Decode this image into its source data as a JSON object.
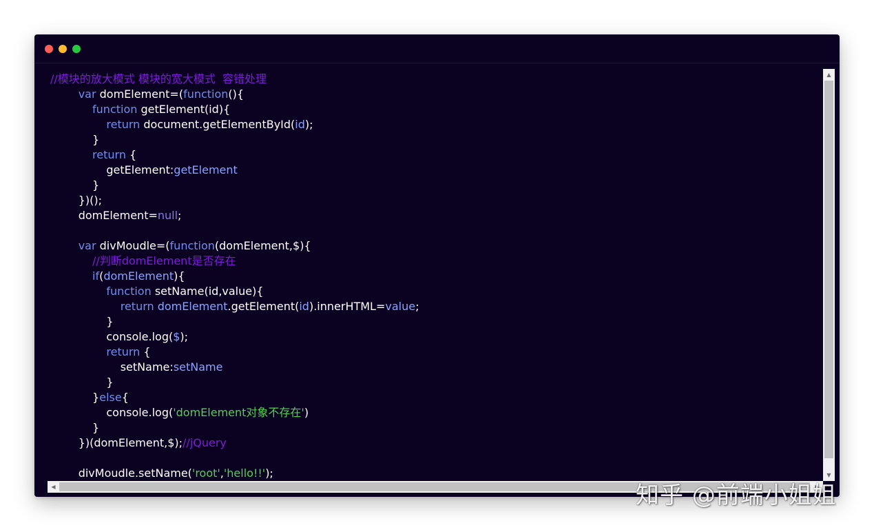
{
  "window": {
    "controls": [
      {
        "name": "close",
        "color": "#ff5f57"
      },
      {
        "name": "minimize",
        "color": "#febc2e"
      },
      {
        "name": "maximize",
        "color": "#28c840"
      }
    ]
  },
  "colors": {
    "background": "#0b0120",
    "comment": "#7a1fd6",
    "keyword": "#6f8ff2",
    "identifier": "#ffffff",
    "string": "#4fd44f",
    "literal": "#8a78e6"
  },
  "code": {
    "lines": [
      [
        [
          "comment",
          "//模块的放大模式 模块的宽大模式  容错处理"
        ]
      ],
      [
        [
          "punct",
          "        "
        ],
        [
          "keyword",
          "var"
        ],
        [
          "ident",
          " domElement="
        ],
        [
          "punct",
          "("
        ],
        [
          "keyword",
          "function"
        ],
        [
          "punct",
          "(){"
        ]
      ],
      [
        [
          "punct",
          "            "
        ],
        [
          "keyword",
          "function"
        ],
        [
          "ident",
          " getElement(id){"
        ]
      ],
      [
        [
          "punct",
          "                "
        ],
        [
          "keyword",
          "return"
        ],
        [
          "ident",
          " document.getElementById("
        ],
        [
          "prop",
          "id"
        ],
        [
          "punct",
          ");"
        ]
      ],
      [
        [
          "punct",
          "            }"
        ]
      ],
      [
        [
          "punct",
          "            "
        ],
        [
          "keyword",
          "return"
        ],
        [
          "punct",
          " {"
        ]
      ],
      [
        [
          "punct",
          "                "
        ],
        [
          "ident",
          "getElement:"
        ],
        [
          "prop",
          "getElement"
        ]
      ],
      [
        [
          "punct",
          "            }"
        ]
      ],
      [
        [
          "punct",
          "        })();"
        ]
      ],
      [
        [
          "punct",
          "        "
        ],
        [
          "ident",
          "domElement="
        ],
        [
          "literal",
          "null"
        ],
        [
          "punct",
          ";"
        ]
      ],
      [
        [
          "punct",
          ""
        ]
      ],
      [
        [
          "punct",
          "        "
        ],
        [
          "keyword",
          "var"
        ],
        [
          "ident",
          " divMoudle="
        ],
        [
          "punct",
          "("
        ],
        [
          "keyword",
          "function"
        ],
        [
          "ident",
          "(domElement,$){"
        ]
      ],
      [
        [
          "punct",
          "            "
        ],
        [
          "comment",
          "//判断domElement是否存在"
        ]
      ],
      [
        [
          "punct",
          "            "
        ],
        [
          "keyword",
          "if"
        ],
        [
          "punct",
          "("
        ],
        [
          "prop",
          "domElement"
        ],
        [
          "punct",
          "){"
        ]
      ],
      [
        [
          "punct",
          "                "
        ],
        [
          "keyword",
          "function"
        ],
        [
          "ident",
          " setName(id,value){"
        ]
      ],
      [
        [
          "punct",
          "                    "
        ],
        [
          "keyword",
          "return"
        ],
        [
          "punct",
          " "
        ],
        [
          "prop",
          "domElement"
        ],
        [
          "ident",
          ".getElement("
        ],
        [
          "prop",
          "id"
        ],
        [
          "ident",
          ").innerHTML="
        ],
        [
          "prop",
          "value"
        ],
        [
          "punct",
          ";"
        ]
      ],
      [
        [
          "punct",
          "                }"
        ]
      ],
      [
        [
          "punct",
          "                "
        ],
        [
          "ident",
          "console.log("
        ],
        [
          "prop",
          "$"
        ],
        [
          "punct",
          ");"
        ]
      ],
      [
        [
          "punct",
          "                "
        ],
        [
          "keyword",
          "return"
        ],
        [
          "punct",
          " {"
        ]
      ],
      [
        [
          "punct",
          "                    "
        ],
        [
          "ident",
          "setName:"
        ],
        [
          "prop",
          "setName"
        ]
      ],
      [
        [
          "punct",
          "                }"
        ]
      ],
      [
        [
          "punct",
          "            }"
        ],
        [
          "keyword",
          "else"
        ],
        [
          "punct",
          "{"
        ]
      ],
      [
        [
          "punct",
          "                "
        ],
        [
          "ident",
          "console.log("
        ],
        [
          "string",
          "'domElement对象不存在'"
        ],
        [
          "punct",
          ")"
        ]
      ],
      [
        [
          "punct",
          "            }"
        ]
      ],
      [
        [
          "punct",
          "        })(domElement,$);"
        ],
        [
          "comment",
          "//jQuery"
        ]
      ],
      [
        [
          "punct",
          ""
        ]
      ],
      [
        [
          "punct",
          "        "
        ],
        [
          "ident",
          "divMoudle.setName("
        ],
        [
          "string",
          "'root'"
        ],
        [
          "punct",
          ","
        ],
        [
          "string",
          "'hello!!'"
        ],
        [
          "punct",
          ");"
        ]
      ]
    ]
  },
  "scrollbars": {
    "vertical": {
      "up_icon": "▲",
      "down_icon": "▼"
    },
    "horizontal": {
      "left_icon": "◀",
      "right_icon": "▶"
    }
  },
  "watermark": {
    "text": "知乎 @前端小姐姐"
  }
}
